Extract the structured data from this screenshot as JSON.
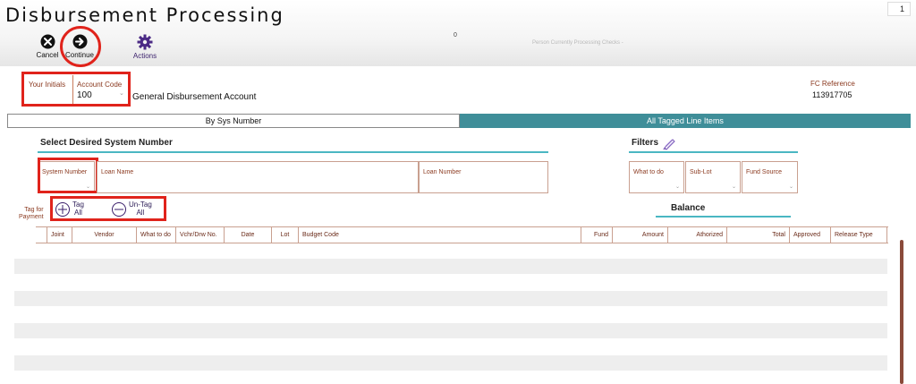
{
  "app": {
    "title": "Disbursement Processing",
    "page_number": "1"
  },
  "toolbar": {
    "cancel_label": "Cancel",
    "continue_label": "Continue",
    "actions_label": "Actions",
    "count": "0",
    "processing_text": "Person Currently Processing Checks -"
  },
  "account": {
    "initials_label": "Your Initials",
    "initials_value": "",
    "code_label": "Account Code",
    "code_value": "100",
    "name": "General Disbursement Account",
    "fc_label": "FC Reference",
    "fc_value": "113917705"
  },
  "tabs": [
    {
      "label": "By Sys Number",
      "active": false
    },
    {
      "label": "All Tagged Line Items",
      "active": true
    }
  ],
  "select": {
    "heading": "Select Desired System Number",
    "fields": [
      {
        "label": "System Number"
      },
      {
        "label": "Loan Name"
      },
      {
        "label": "Loan Number"
      }
    ]
  },
  "filters": {
    "heading": "Filters",
    "fields": [
      {
        "label": "What to do"
      },
      {
        "label": "Sub-Lot"
      },
      {
        "label": "Fund Source"
      }
    ]
  },
  "tagging": {
    "tag_for_label_1": "Tag for",
    "tag_for_label_2": "Payment",
    "tag_all_1": "Tag",
    "tag_all_2": "All",
    "untag_all_1": "Un-Tag",
    "untag_all_2": "All"
  },
  "balance": {
    "heading": "Balance"
  },
  "table": {
    "columns": [
      "Joint",
      "Vendor",
      "What to do",
      "Vchr/Drw No.",
      "Date",
      "Lot",
      "Budget Code",
      "Fund",
      "Amount",
      "Athorized",
      "Total",
      "Approved",
      "Release Type"
    ],
    "rows": []
  },
  "colors": {
    "accent_teal": "#3f8e99",
    "highlight_red": "#e0231b",
    "label_brown": "#8b3a20"
  },
  "icons": [
    "close-icon",
    "arrow-right-icon",
    "gear-icon",
    "pencil-icon",
    "plus-circle-icon",
    "minus-circle-icon"
  ]
}
